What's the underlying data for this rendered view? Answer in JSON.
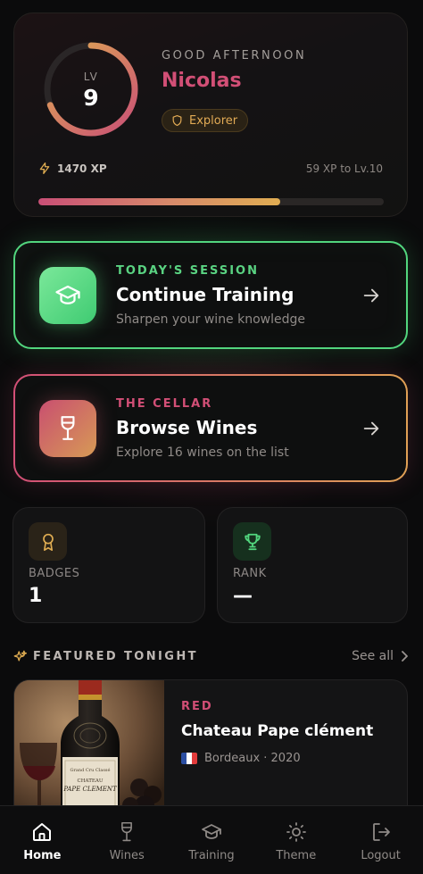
{
  "profile": {
    "level_label": "LV",
    "level": "9",
    "level_progress": 0.69,
    "greeting": "GOOD AFTERNOON",
    "name": "Nicolas",
    "rank_title": "Explorer",
    "xp_text": "1470 XP",
    "xp_to_next_text": "59 XP to Lv.10",
    "xp_progress": 0.7
  },
  "training_card": {
    "eyebrow": "TODAY'S SESSION",
    "title": "Continue Training",
    "subtitle": "Sharpen your wine knowledge"
  },
  "cellar_card": {
    "eyebrow": "THE CELLAR",
    "title": "Browse Wines",
    "subtitle": "Explore 16 wines on the list"
  },
  "stats": {
    "badges_label": "BADGES",
    "badges_value": "1",
    "rank_label": "RANK",
    "rank_value": "—"
  },
  "featured": {
    "heading": "FEATURED TONIGHT",
    "see_all": "See all",
    "wine": {
      "type": "RED",
      "name": "Chateau Pape clément",
      "meta": "Bordeaux · 2020",
      "label_line1": "Grand Cru Classé",
      "label_line2": "CHATEAU",
      "label_line3": "PAPE CLEMENT"
    }
  },
  "nav": {
    "home": "Home",
    "wines": "Wines",
    "training": "Training",
    "theme": "Theme",
    "logout": "Logout"
  },
  "colors": {
    "accent_pink": "#d24f76",
    "accent_gold": "#e0ad52",
    "accent_green": "#52d67e"
  }
}
